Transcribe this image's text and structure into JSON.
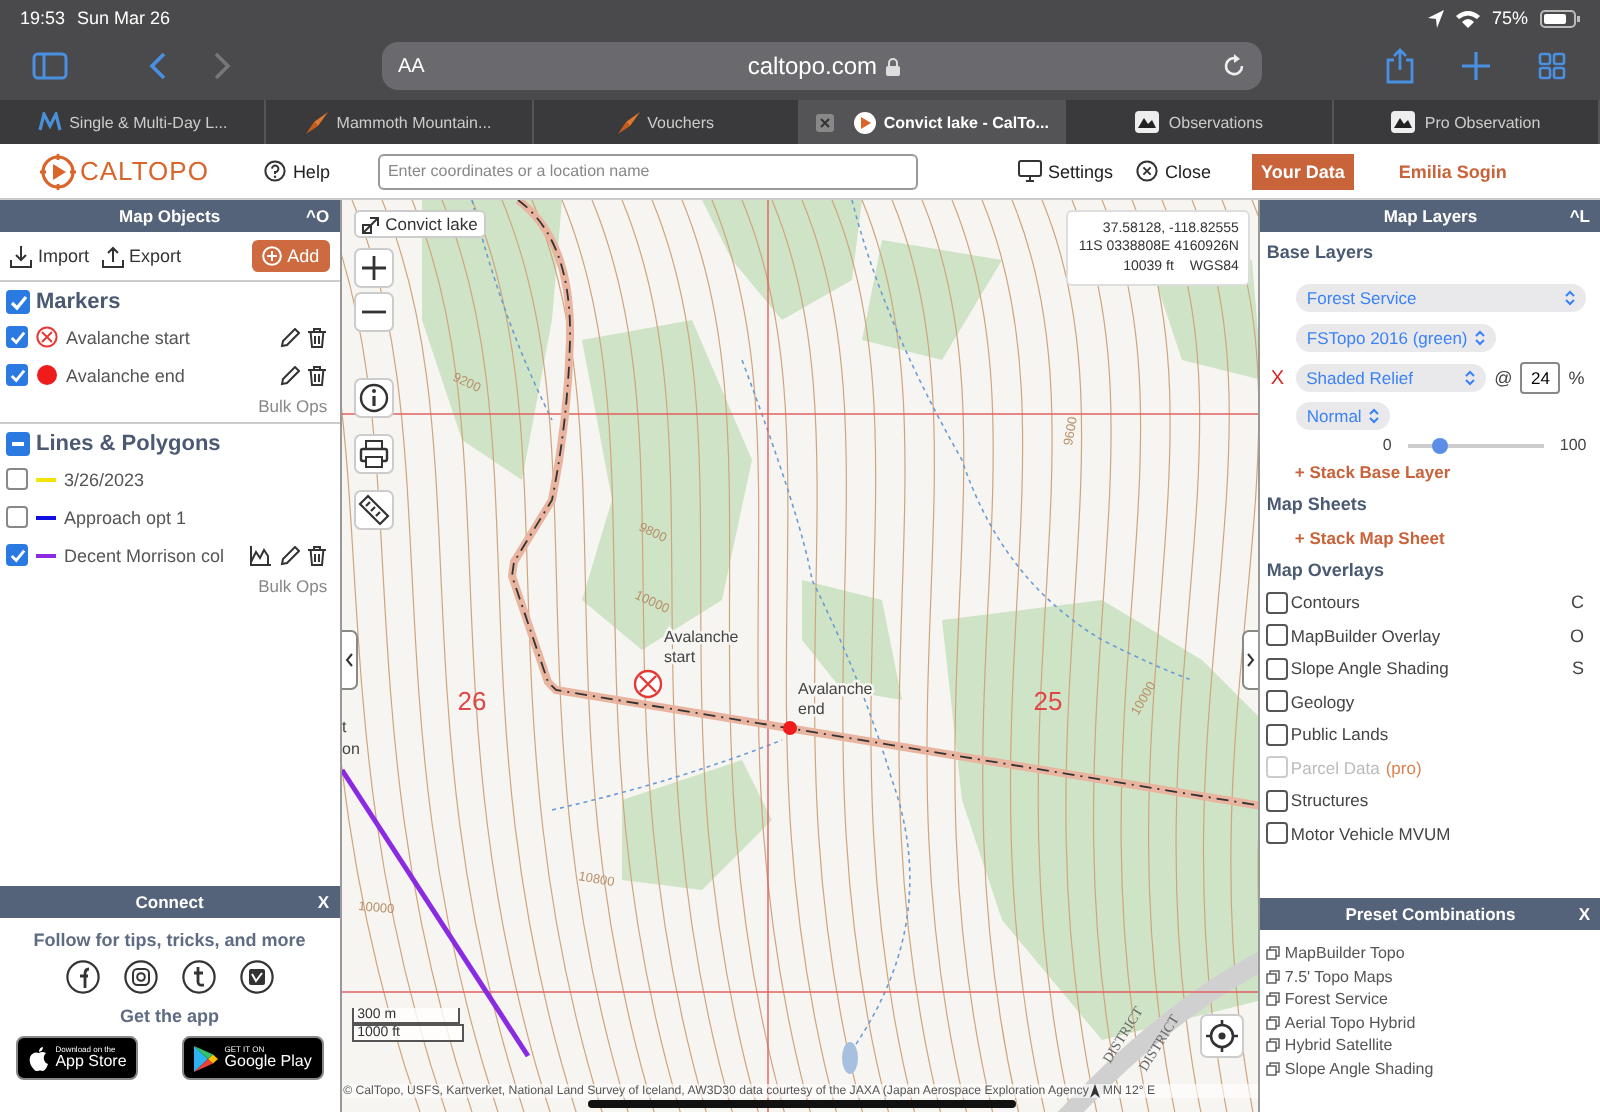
{
  "status_bar": {
    "time": "19:53",
    "date": "Sun Mar 26",
    "battery": "75%"
  },
  "browser": {
    "text_size": "AA",
    "address": "caltopo.com",
    "back_enabled": true,
    "forward_enabled": false
  },
  "tabs": [
    {
      "title": "Single & Multi-Day L...",
      "kind": "wave",
      "selected": false
    },
    {
      "title": "Mammoth Mountain...",
      "kind": "arrow",
      "selected": false
    },
    {
      "title": "Vouchers",
      "kind": "arrow",
      "selected": false
    },
    {
      "title": "Convict lake - CalTo...",
      "kind": "caltopo",
      "selected": true
    },
    {
      "title": "Observations",
      "kind": "crest",
      "selected": false
    },
    {
      "title": "Pro Observation",
      "kind": "crest",
      "selected": false
    }
  ],
  "app_header": {
    "logo": "CALTOPO",
    "help": "Help",
    "search": {
      "placeholder": "Enter coordinates or a location name"
    },
    "settings": "Settings",
    "close": "Close",
    "your_data": "Your Data",
    "user": "Emilia Sogin"
  },
  "map_objects": {
    "title": "Map Objects",
    "shortcut": "^O",
    "import": "Import",
    "export": "Export",
    "add": "Add",
    "sections": [
      {
        "title": "Markers",
        "checked": true,
        "partial": false,
        "bulk": "Bulk Ops",
        "items": [
          {
            "label": "Avalanche start",
            "kind": "crossed",
            "checked": true,
            "color": "#e53935",
            "editable": true,
            "profile": false
          },
          {
            "label": "Avalanche end",
            "kind": "dot",
            "checked": true,
            "color": "#ee1c1c",
            "editable": true,
            "profile": false
          }
        ]
      },
      {
        "title": "Lines & Polygons",
        "checked": true,
        "partial": true,
        "bulk": "Bulk Ops",
        "items": [
          {
            "label": "3/26/2023",
            "kind": "line",
            "checked": false,
            "color": "#f0e400",
            "editable": false,
            "profile": false
          },
          {
            "label": "Approach opt 1",
            "kind": "line",
            "checked": false,
            "color": "#1010e0",
            "editable": false,
            "profile": false
          },
          {
            "label": "Decent Morrison col",
            "kind": "line",
            "checked": true,
            "color": "#8a2be2",
            "editable": true,
            "profile": true
          }
        ]
      }
    ]
  },
  "connect": {
    "title": "Connect",
    "close": "X",
    "follow": "Follow for tips, tricks, and more",
    "get_app": "Get the app",
    "app_store": {
      "small": "Download on the",
      "big": "App Store"
    },
    "google_play": {
      "small": "GET IT ON",
      "big": "Google Play"
    }
  },
  "map": {
    "search_result": "Convict lake",
    "coords": [
      "37.58128, -118.82555",
      "11S 0338808E 4160926N"
    ],
    "elevation": "10039 ft",
    "datum": "WGS84",
    "sections": [
      "26",
      "25"
    ],
    "markers": [
      {
        "kind": "crossed",
        "label_lines": [
          "Avalanche",
          "start"
        ]
      },
      {
        "kind": "dot",
        "label_lines": [
          "Avalanche",
          "end"
        ]
      }
    ],
    "contour_labels": [
      "9200",
      "9800",
      "10000",
      "10800",
      "10000",
      "9600",
      "10000"
    ],
    "cut_label": [
      "t",
      "on"
    ],
    "districts": [
      "DISTRICT",
      "DISTRICT"
    ],
    "scale": [
      "300 m",
      "1000 ft"
    ],
    "attribution": "© CalTopo, USFS, Kartverket, National Land Survey of Iceland, AW3D30 data courtesy of the JAXA (Japan Aerospace Exploration Agency",
    "declination": "MN 12° E"
  },
  "map_layers": {
    "title": "Map Layers",
    "shortcut": "^L",
    "base_heading": "Base Layers",
    "base": "Forest Service",
    "sublayer": "FSTopo 2016 (green)",
    "stack": {
      "remove": "X",
      "layer": "Shaded Relief",
      "at": "@",
      "opacity": "24",
      "unit": "%",
      "blend": "Normal",
      "min": "0",
      "max": "100",
      "level": 0.24
    },
    "stack_base": "+ Stack Base Layer",
    "sheets_heading": "Map Sheets",
    "stack_sheet": "+ Stack Map Sheet",
    "overlays_heading": "Map Overlays",
    "overlays": [
      {
        "label": "Contours",
        "shortcut": "C",
        "checked": false,
        "disabled": false
      },
      {
        "label": "MapBuilder Overlay",
        "shortcut": "O",
        "checked": false,
        "disabled": false
      },
      {
        "label": "Slope Angle Shading",
        "shortcut": "S",
        "checked": false,
        "disabled": false
      },
      {
        "label": "Geology",
        "checked": false,
        "disabled": false
      },
      {
        "label": "Public Lands",
        "checked": false,
        "disabled": false
      },
      {
        "label": "Parcel Data",
        "badge": "(pro)",
        "checked": false,
        "disabled": true
      },
      {
        "label": "Structures",
        "checked": false,
        "disabled": false
      },
      {
        "label": "Motor Vehicle MVUM",
        "checked": false,
        "disabled": false
      }
    ]
  },
  "presets": {
    "title": "Preset Combinations",
    "close": "X",
    "items": [
      "MapBuilder Topo",
      "7.5' Topo Maps",
      "Forest Service",
      "Aerial Topo Hybrid",
      "Hybrid Satellite",
      "Slope Angle Shading"
    ]
  }
}
